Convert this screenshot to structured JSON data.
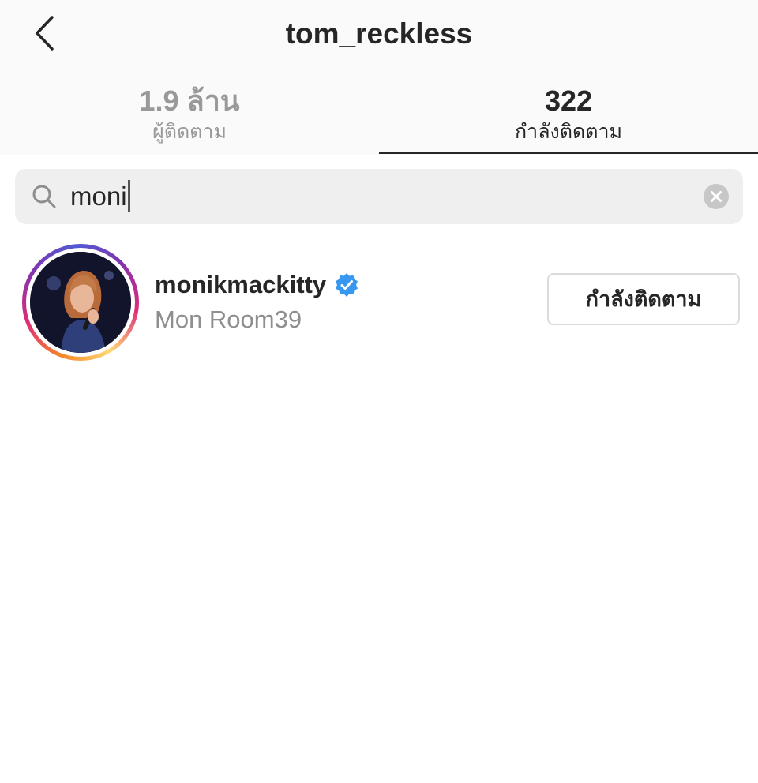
{
  "header": {
    "title": "tom_reckless",
    "back_icon": "chevron-left-icon"
  },
  "tabs": [
    {
      "count": "1.9 ล้าน",
      "label": "ผู้ติดตาม",
      "active": false
    },
    {
      "count": "322",
      "label": "กำลังติดตาม",
      "active": true
    }
  ],
  "search": {
    "value": "moni",
    "icon": "search-icon",
    "clear_icon": "clear-icon"
  },
  "results": [
    {
      "username": "monikmackitty",
      "verified": true,
      "full_name": "Mon Room39",
      "button_label": "กำลังติดตาม"
    }
  ],
  "colors": {
    "header_bg": "#fafafa",
    "search_bg": "#efefef",
    "verified_blue": "#3897f0",
    "muted_text": "#8e8e8e",
    "primary_text": "#262626"
  }
}
